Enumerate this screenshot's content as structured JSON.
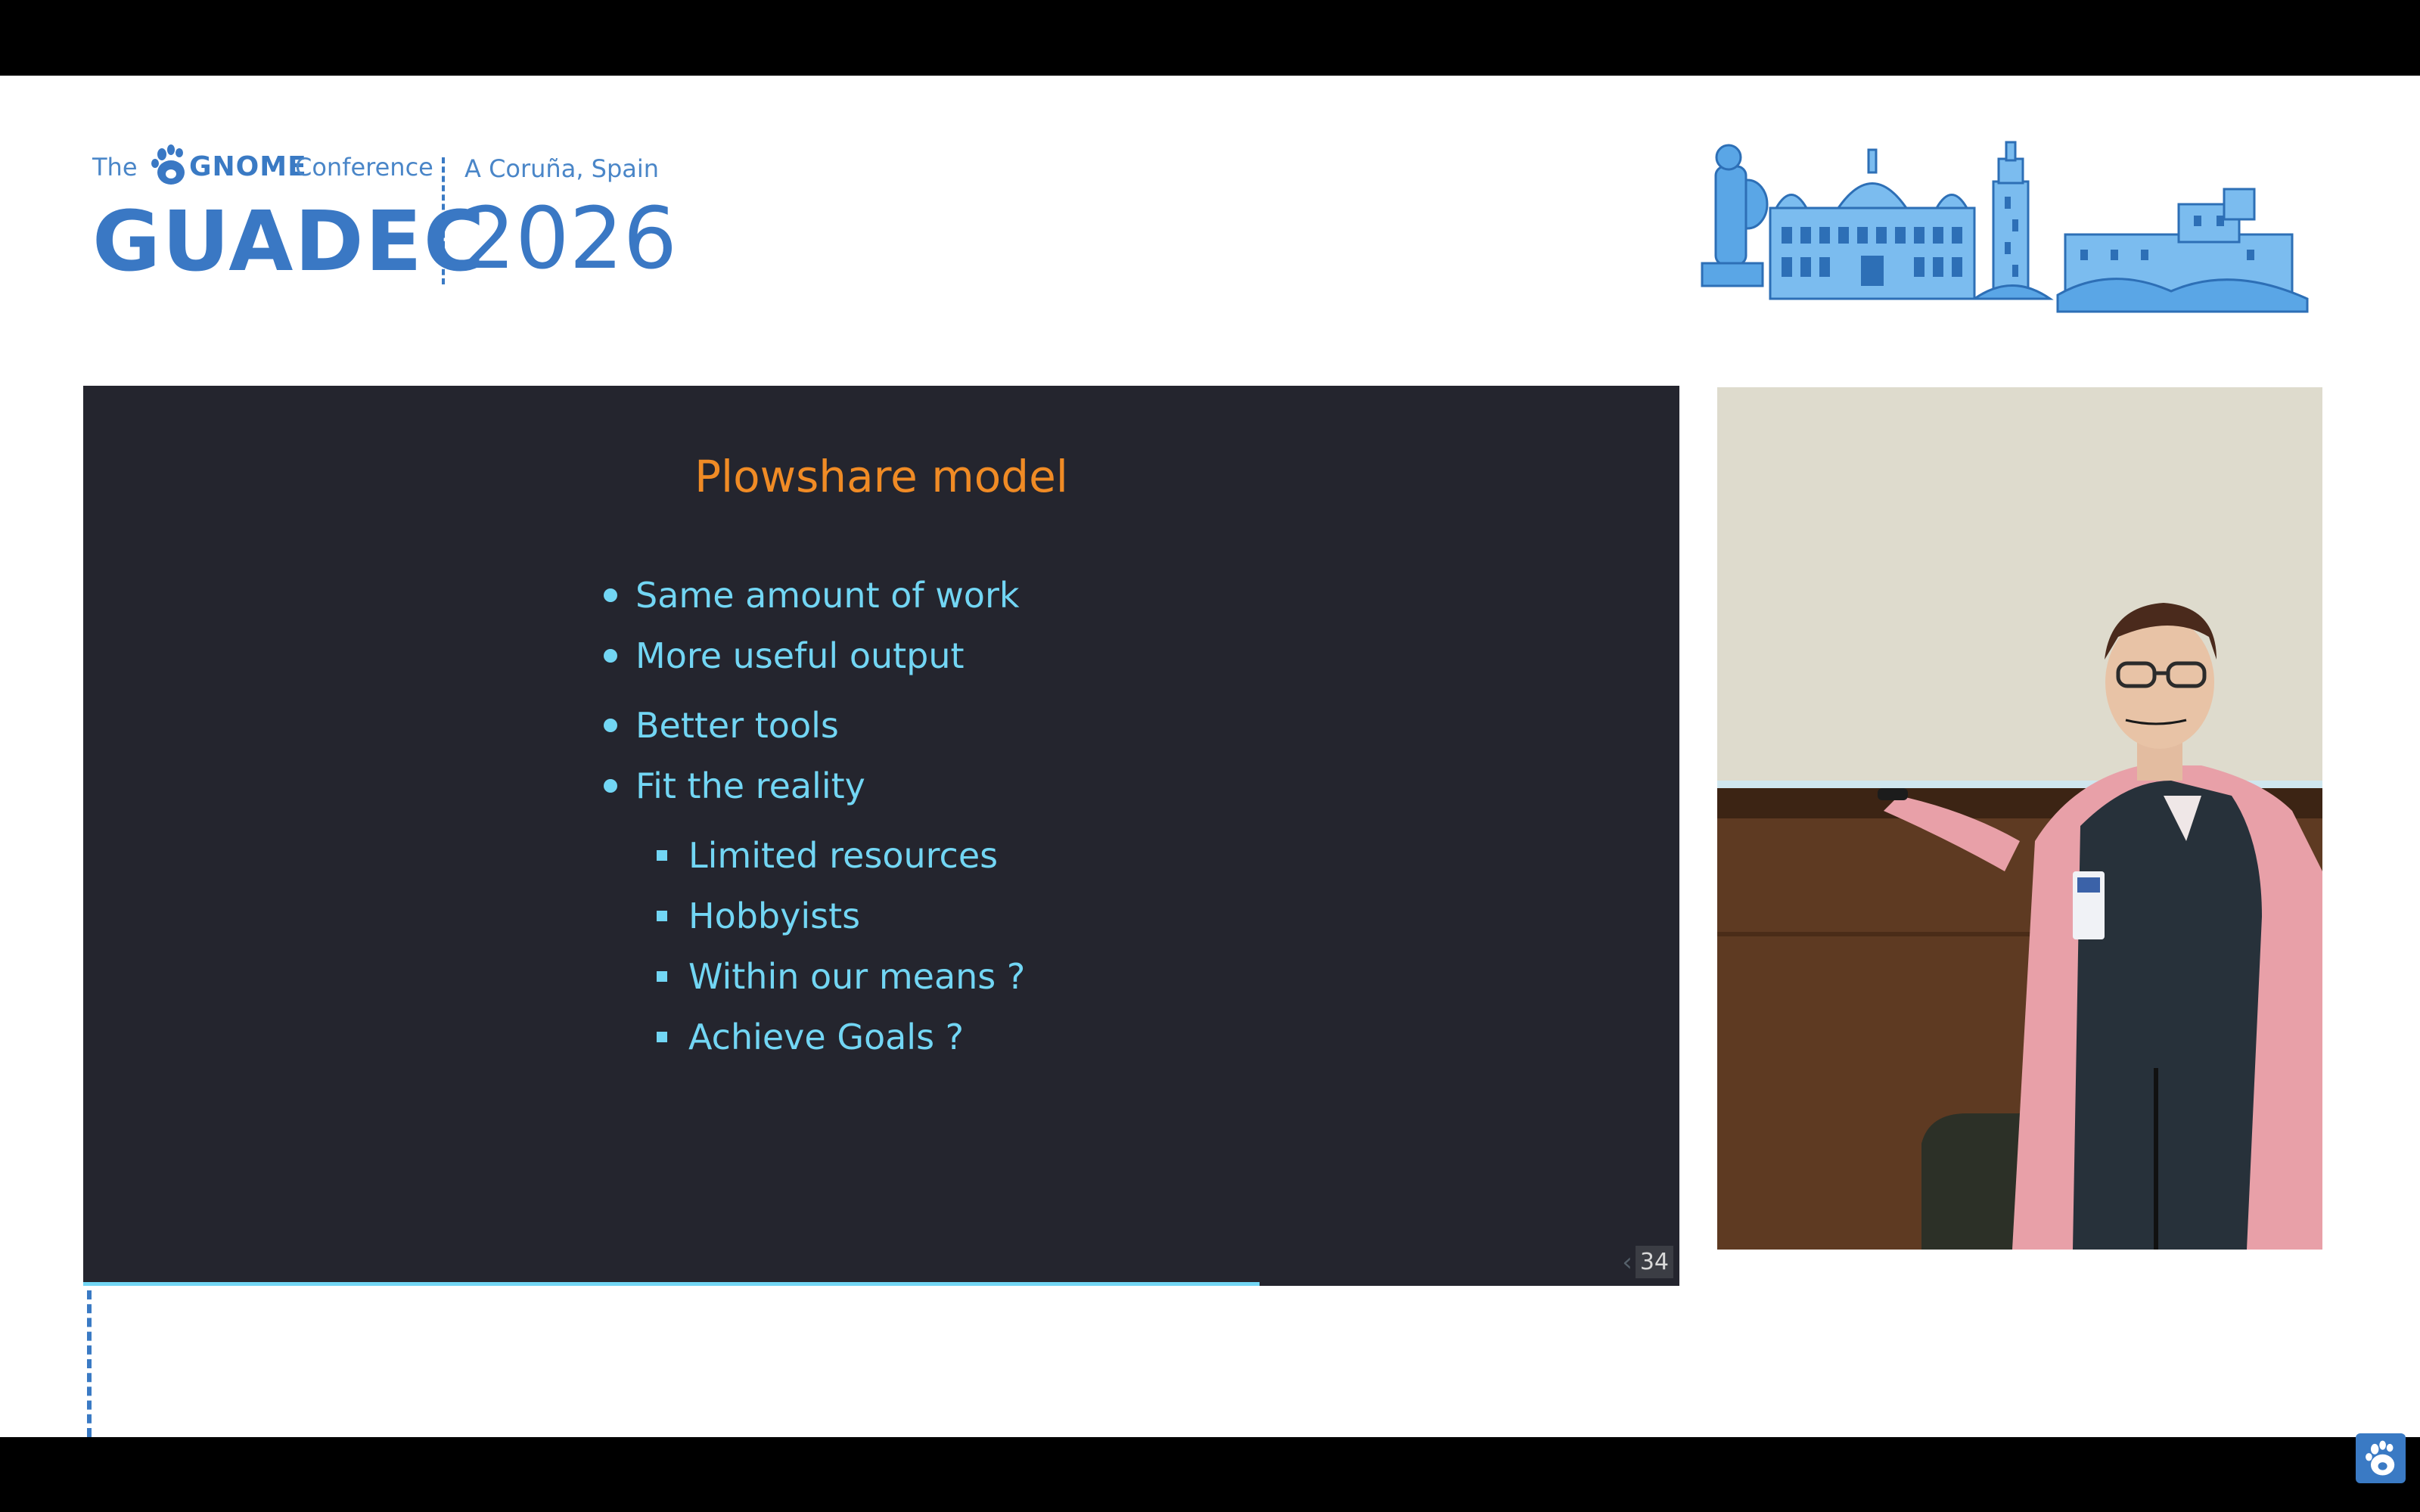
{
  "header": {
    "the": "The",
    "gnome": "GNOME",
    "conference": "Conference",
    "location": "A Coruña, Spain",
    "event": "GUADEC",
    "year": "2026"
  },
  "slide": {
    "title": "Plowshare model",
    "bullets": [
      "Same amount of work",
      "More useful output",
      "Better tools",
      "Fit the reality"
    ],
    "subbullets": [
      "Limited resources",
      "Hobbyists",
      "Within our means ?",
      "Achieve Goals ?"
    ],
    "page_number": "34",
    "progress_fraction": 0.737
  },
  "colors": {
    "brand_blue": "#3a7ac4",
    "slide_bg": "#24252e",
    "title_orange": "#f08b25",
    "bullet_cyan": "#72d6f4"
  },
  "icons": {
    "gnome_foot": "gnome-foot-icon",
    "skyline": "a-coruna-skyline-illustration",
    "prev": "chevron-left-icon",
    "gnome_badge": "gnome-logo-icon"
  }
}
